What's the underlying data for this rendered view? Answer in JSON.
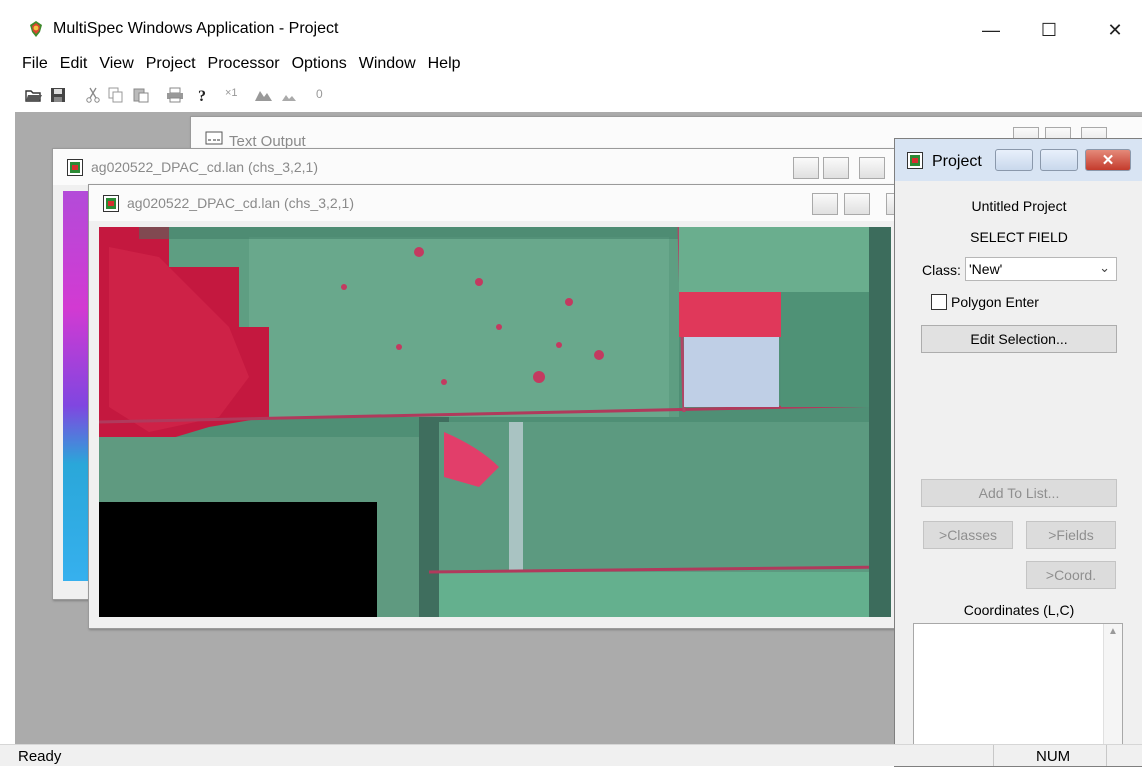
{
  "app": {
    "title": "MultiSpec Windows Application - Project"
  },
  "window_controls": {
    "minimize": "—",
    "maximize": "☐",
    "close": "✕"
  },
  "menu": [
    "File",
    "Edit",
    "View",
    "Project",
    "Processor",
    "Options",
    "Window",
    "Help"
  ],
  "toolbar": {
    "icons": [
      "open-folder-icon",
      "save-icon",
      "cut-icon",
      "copy-icon",
      "paste-icon",
      "print-icon",
      "help-pointer-icon",
      "zoom-x1-icon",
      "zoom-in-icon",
      "zoom-out-icon",
      "overlay-icon"
    ],
    "zoom_x1": "×1",
    "overlay": "0"
  },
  "windows": {
    "text_output": {
      "title": "Text Output"
    },
    "image_back": {
      "title": "ag020522_DPAC_cd.lan (chs_3,2,1)"
    },
    "image_front": {
      "title": "ag020522_DPAC_cd.lan (chs_3,2,1)"
    }
  },
  "project_panel": {
    "title": "Project",
    "project_name": "Untitled Project",
    "mode": "SELECT FIELD",
    "class_label": "Class:",
    "class_value": "'New'",
    "polygon_enter_label": "Polygon Enter",
    "polygon_enter_checked": false,
    "edit_selection": "Edit Selection...",
    "add_to_list": "Add To List...",
    "classes_button": ">Classes",
    "fields_button": ">Fields",
    "coord_button": ">Coord.",
    "coordinates_label": "Coordinates (L,C)",
    "coordinates_value": ""
  },
  "status": {
    "text": "Ready",
    "num": "NUM"
  },
  "colors": {
    "mdi_background": "#ababab",
    "project_title": "#d8e4f3",
    "close_red": "#c9483b"
  }
}
